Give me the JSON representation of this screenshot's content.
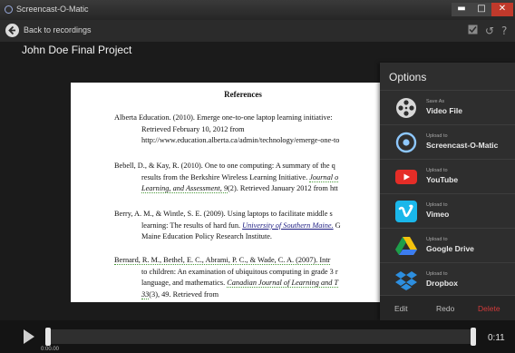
{
  "window": {
    "title": "Screencast-O-Matic",
    "min_glyph": "▬",
    "max_glyph": "□",
    "close_glyph": "✕"
  },
  "nav": {
    "back_label": "Back to recordings",
    "history_glyph": "↺",
    "help_glyph": "?"
  },
  "project": {
    "title": "John Doe Final Project"
  },
  "document": {
    "heading": "References",
    "refs": [
      {
        "l1": "Alberta Education. (2010). Emerge one-to-one laptop learning initiative:",
        "l2": "Retrieved February 10, 2012 from",
        "l3": "http://www.education.alberta.ca/admin/technology/emerge-one-to"
      },
      {
        "l1": "Bebell, D., & Kay, R. (2010). One to one computing: A summary of the q",
        "l2a": "results from the Berkshire Wireless Learning Initiative. ",
        "l2b": "Journal o",
        "l3a": "Learning, and Assessment, 9",
        "l3b": "(2). Retrieved January 2012 from htt"
      },
      {
        "l1a": "Berry, A. M., & Wintle, S. E. (2009). Using laptops to facilitate middle s",
        "l2a": "learning: The results of hard fun. ",
        "l2b": "University of Southern Maine.",
        "l2c": " G",
        "l3": "Maine Education Policy Research Institute."
      },
      {
        "l1a": "Bernard, R. M., Bethel, E. C., Abrami, P. C., & Wade, C. A. (2007). Intr",
        "l2": "to children: An examination of ubiquitous computing in grade 3 r",
        "l3a": "language, and mathematics. ",
        "l3b": "Canadian Journal of Learning and T",
        "l4a": "33",
        "l4b": "(3), 49. Retrieved from"
      }
    ]
  },
  "options": {
    "title": "Options",
    "items": [
      {
        "small": "Save As",
        "main": "Video File",
        "icon": "film-reel-icon"
      },
      {
        "small": "Upload to",
        "main": "Screencast-O-Matic",
        "icon": "screencast-o-matic-icon"
      },
      {
        "small": "Upload to",
        "main": "YouTube",
        "icon": "youtube-icon"
      },
      {
        "small": "Upload to",
        "main": "Vimeo",
        "icon": "vimeo-icon"
      },
      {
        "small": "Upload to",
        "main": "Google Drive",
        "icon": "google-drive-icon"
      },
      {
        "small": "Upload to",
        "main": "Dropbox",
        "icon": "dropbox-icon"
      }
    ],
    "footer": {
      "edit": "Edit",
      "redo": "Redo",
      "delete": "Delete"
    }
  },
  "player": {
    "current_time": "0:00.00",
    "end_time": "0:11",
    "play_icon": "play-icon",
    "position_fraction": 0
  },
  "colors": {
    "delete": "#d03a3a",
    "youtube": "#e52d27",
    "vimeo": "#1ab7ea",
    "dropbox": "#2d8fe0",
    "som_ring": "#8ec8ff"
  }
}
